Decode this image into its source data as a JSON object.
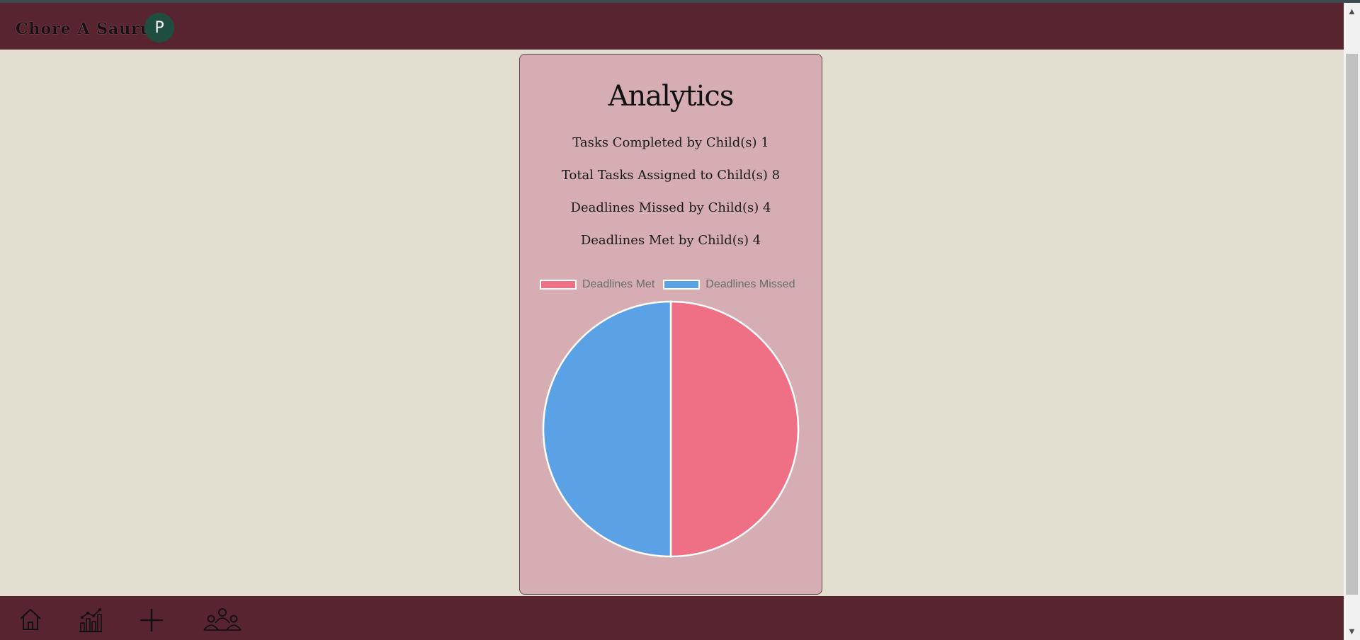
{
  "header": {
    "app_title": "Chore A Saurus",
    "avatar_initial": "P"
  },
  "analytics": {
    "title": "Analytics",
    "stats": [
      "Tasks Completed by Child(s) 1",
      "Total Tasks Assigned to Child(s) 8",
      "Deadlines Missed by Child(s) 4",
      "Deadlines Met by Child(s) 4"
    ]
  },
  "chart_data": {
    "type": "pie",
    "categories": [
      "Deadlines Met",
      "Deadlines Missed"
    ],
    "values": [
      4,
      4
    ],
    "colors": [
      "#ef6f85",
      "#5ba1e5"
    ],
    "title": "",
    "legend": "top"
  },
  "footer": {
    "nav": [
      {
        "icon": "home-icon"
      },
      {
        "icon": "analytics-icon"
      },
      {
        "icon": "add-icon"
      },
      {
        "icon": "family-icon"
      }
    ]
  },
  "colors": {
    "background": "#e2ded0",
    "header": "#582430",
    "card": "#d5adb2",
    "avatar": "#1f4d3f"
  }
}
